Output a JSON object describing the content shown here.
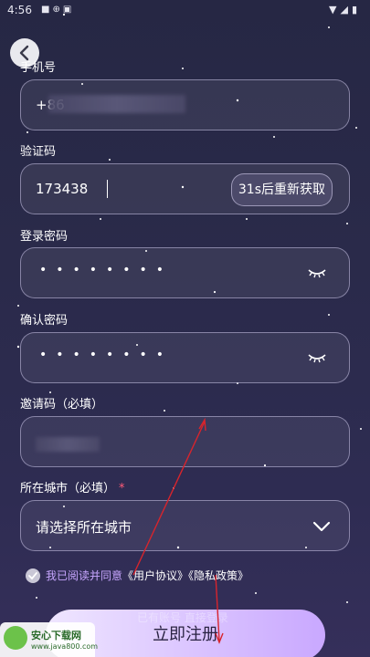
{
  "status_bar": {
    "time": "4:56",
    "left_icons": [
      "notification-icon",
      "notification-icon",
      "notification-icon"
    ],
    "right_icons": [
      "wifi-icon",
      "signal-icon",
      "battery-icon"
    ]
  },
  "form": {
    "phone": {
      "label": "手机号",
      "value": "+86"
    },
    "code": {
      "label": "验证码",
      "value": "173438",
      "resend_label": "31s后重新获取"
    },
    "password": {
      "label": "登录密码",
      "mask": "••••••••"
    },
    "confirm": {
      "label": "确认密码",
      "mask": "••••••••"
    },
    "invite": {
      "label": "邀请码（必填）"
    },
    "city": {
      "label": "所在城市（必填）",
      "required_mark": "*",
      "placeholder": "请选择所在城市"
    }
  },
  "agreement": {
    "main": "我已阅读并同意",
    "user_link": "《用户协议》",
    "privacy_link": "《隐私政策》"
  },
  "login_hint": "已有账号 直接登录",
  "submit_label": "立即注册",
  "watermark": {
    "title": "安心下载网",
    "url": "www.java800.com"
  },
  "colors": {
    "accent": "#c7a6ff",
    "background": "#262744",
    "required": "#ff5b78"
  }
}
